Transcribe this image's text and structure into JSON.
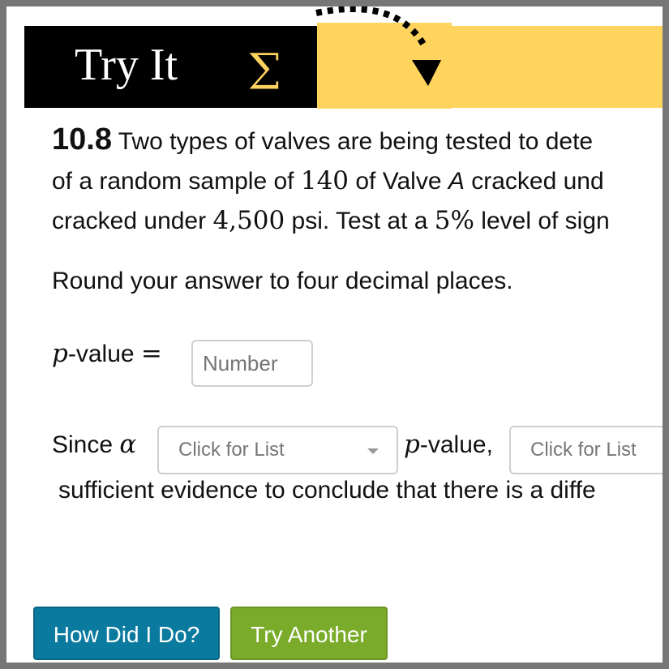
{
  "banner": {
    "title": "Try It",
    "sigma_glyph": "Σ",
    "colors": {
      "black": "#000000",
      "yellow": "#fed35e",
      "sigma": "#fed35e"
    }
  },
  "question": {
    "number": "10.8",
    "line1": "Two types of valves are being tested to dete",
    "line2_a": "of a random sample of",
    "line2_num": "140",
    "line2_b": "of Valve",
    "line2_valve": "A",
    "line2_c": "cracked und",
    "line3_a": "cracked under",
    "line3_num": "4,500",
    "line3_b": "psi. Test at a",
    "line3_pct": "5%",
    "line3_c": "level of sign",
    "round_instruction": "Round your answer to four decimal places."
  },
  "pvalue": {
    "p_symbol": "p",
    "label": "-value",
    "equals": "=",
    "input_placeholder": "Number"
  },
  "since": {
    "since_label": "Since",
    "alpha": "α",
    "select1_value": "Click for List",
    "p_symbol": "p",
    "pvalue_label": "-value,",
    "select2_value": "Click for List",
    "sufficient_line": "sufficient evidence to conclude that there is a diffe"
  },
  "buttons": {
    "how_did_i_do": "How Did I Do?",
    "try_another": "Try Another",
    "colors": {
      "how": "#0a7a9e",
      "try": "#7aab2b"
    }
  }
}
